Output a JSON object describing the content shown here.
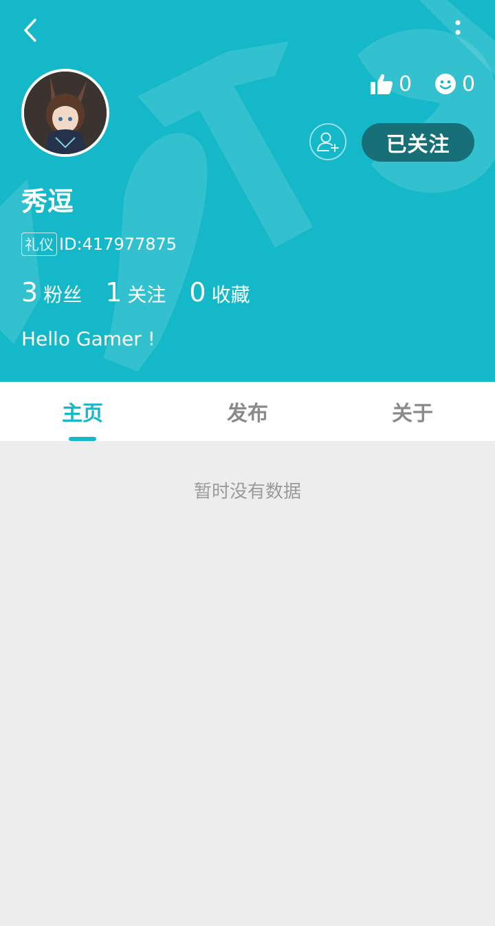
{
  "header": {
    "background_color": "#15b8c9",
    "back_icon": "chevron-left-icon",
    "more_icon": "more-vertical-icon"
  },
  "profile": {
    "username": "秀逗",
    "tag": "礼仪",
    "id_text": "ID:417977875",
    "likes_count": "0",
    "emoji_count": "0",
    "follow_button_label": "已关注",
    "bio": "Hello Gamer !",
    "stats": [
      {
        "value": "3",
        "label": "粉丝"
      },
      {
        "value": "1",
        "label": "关注"
      },
      {
        "value": "0",
        "label": "收藏"
      }
    ]
  },
  "tabs": [
    {
      "label": "主页",
      "active": true
    },
    {
      "label": "发布",
      "active": false
    },
    {
      "label": "关于",
      "active": false
    }
  ],
  "content": {
    "empty_text": "暂时没有数据"
  },
  "colors": {
    "accent": "#15b8c9",
    "follow_button": "#176f77",
    "page_bg": "#ededed"
  }
}
